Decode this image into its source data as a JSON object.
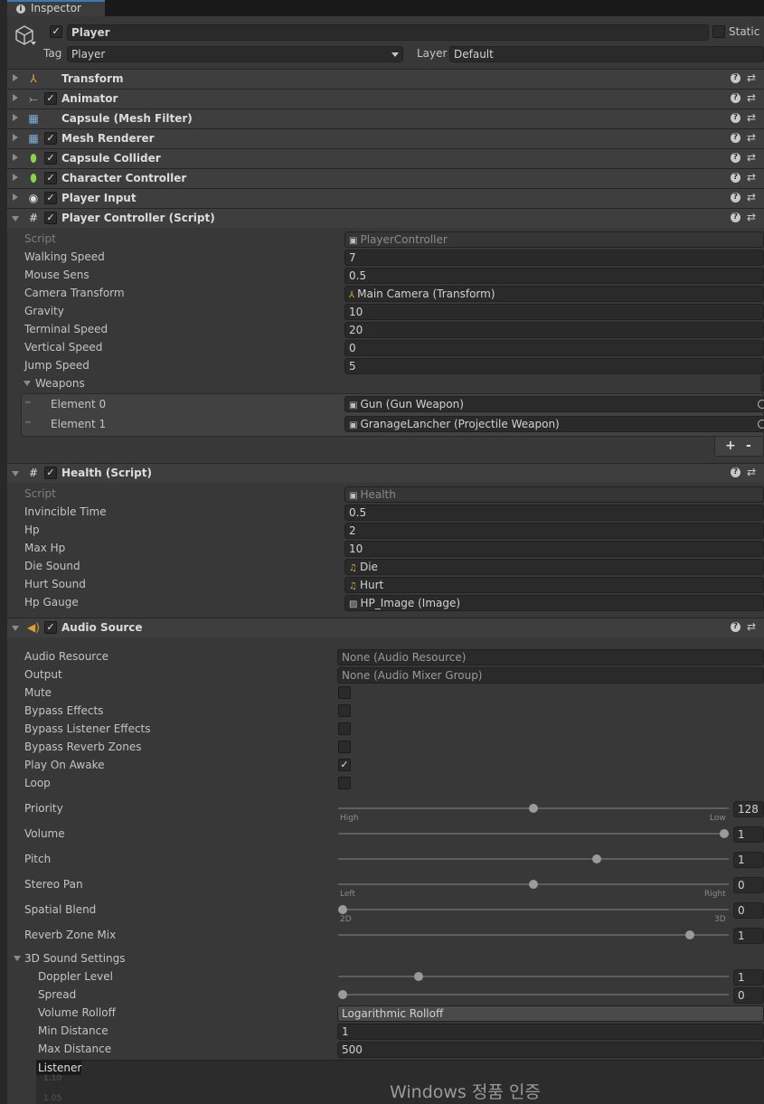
{
  "window": {
    "tab_label": "Inspector"
  },
  "object": {
    "name": "Player",
    "static_label": "Static",
    "tag_label": "Tag",
    "tag_value": "Player",
    "layer_label": "Layer",
    "layer_value": "Default"
  },
  "components": [
    {
      "title": "Transform",
      "icon": "transform-icon"
    },
    {
      "title": "Animator",
      "icon": "animator-icon"
    },
    {
      "title": "Capsule (Mesh Filter)",
      "icon": "mesh-filter-icon"
    },
    {
      "title": "Mesh Renderer",
      "icon": "mesh-renderer-icon"
    },
    {
      "title": "Capsule Collider",
      "icon": "capsule-collider-icon"
    },
    {
      "title": "Character Controller",
      "icon": "character-controller-icon"
    },
    {
      "title": "Player Input",
      "icon": "player-input-icon"
    },
    {
      "title": "Player Controller (Script)",
      "icon": "script-icon"
    },
    {
      "title": "Health (Script)",
      "icon": "script-icon"
    },
    {
      "title": "Audio Source",
      "icon": "audio-source-icon"
    }
  ],
  "player_controller": {
    "script_label": "Script",
    "script_value": "PlayerController",
    "walking_speed_label": "Walking Speed",
    "walking_speed": "7",
    "mouse_sens_label": "Mouse Sens",
    "mouse_sens": "0.5",
    "camera_transform_label": "Camera Transform",
    "camera_transform": "Main Camera (Transform)",
    "gravity_label": "Gravity",
    "gravity": "10",
    "terminal_speed_label": "Terminal Speed",
    "terminal_speed": "20",
    "vertical_speed_label": "Vertical Speed",
    "vertical_speed": "0",
    "jump_speed_label": "Jump Speed",
    "jump_speed": "5",
    "weapons_label": "Weapons",
    "weapons": [
      {
        "label": "Element 0",
        "value": "Gun (Gun Weapon)"
      },
      {
        "label": "Element 1",
        "value": "GranageLancher (Projectile Weapon)"
      }
    ],
    "add_label": "+",
    "remove_label": "-"
  },
  "health": {
    "script_label": "Script",
    "script_value": "Health",
    "invincible_time_label": "Invincible Time",
    "invincible_time": "0.5",
    "hp_label": "Hp",
    "hp": "2",
    "max_hp_label": "Max Hp",
    "max_hp": "10",
    "die_sound_label": "Die Sound",
    "die_sound": "Die",
    "hurt_sound_label": "Hurt Sound",
    "hurt_sound": "Hurt",
    "hp_gauge_label": "Hp Gauge",
    "hp_gauge": "HP_Image (Image)"
  },
  "audio_source": {
    "audio_resource_label": "Audio Resource",
    "audio_resource": "None (Audio Resource)",
    "output_label": "Output",
    "output": "None (Audio Mixer Group)",
    "mute_label": "Mute",
    "mute": false,
    "bypass_effects_label": "Bypass Effects",
    "bypass_effects": false,
    "bypass_listener_label": "Bypass Listener Effects",
    "bypass_listener": false,
    "bypass_reverb_label": "Bypass Reverb Zones",
    "bypass_reverb": false,
    "play_on_awake_label": "Play On Awake",
    "play_on_awake": true,
    "loop_label": "Loop",
    "loop": false,
    "priority_label": "Priority",
    "priority": "128",
    "priority_min_label": "High",
    "priority_max_label": "Low",
    "volume_label": "Volume",
    "volume": "1",
    "pitch_label": "Pitch",
    "pitch": "1",
    "stereo_pan_label": "Stereo Pan",
    "stereo_pan": "0",
    "pan_left_label": "Left",
    "pan_right_label": "Right",
    "spatial_blend_label": "Spatial Blend",
    "spatial_blend": "0",
    "blend_min_label": "2D",
    "blend_max_label": "3D",
    "reverb_mix_label": "Reverb Zone Mix",
    "reverb_mix": "1",
    "sound3d_label": "3D Sound Settings",
    "doppler_label": "Doppler Level",
    "doppler": "1",
    "spread_label": "Spread",
    "spread": "0",
    "rolloff_label": "Volume Rolloff",
    "rolloff": "Logarithmic Rolloff",
    "min_distance_label": "Min Distance",
    "min_distance": "1",
    "max_distance_label": "Max Distance",
    "max_distance": "500",
    "listener_label": "Listener",
    "graph_tick_1": "1.10",
    "graph_tick_2": "1.05"
  },
  "watermark": "Windows 정품 인증"
}
